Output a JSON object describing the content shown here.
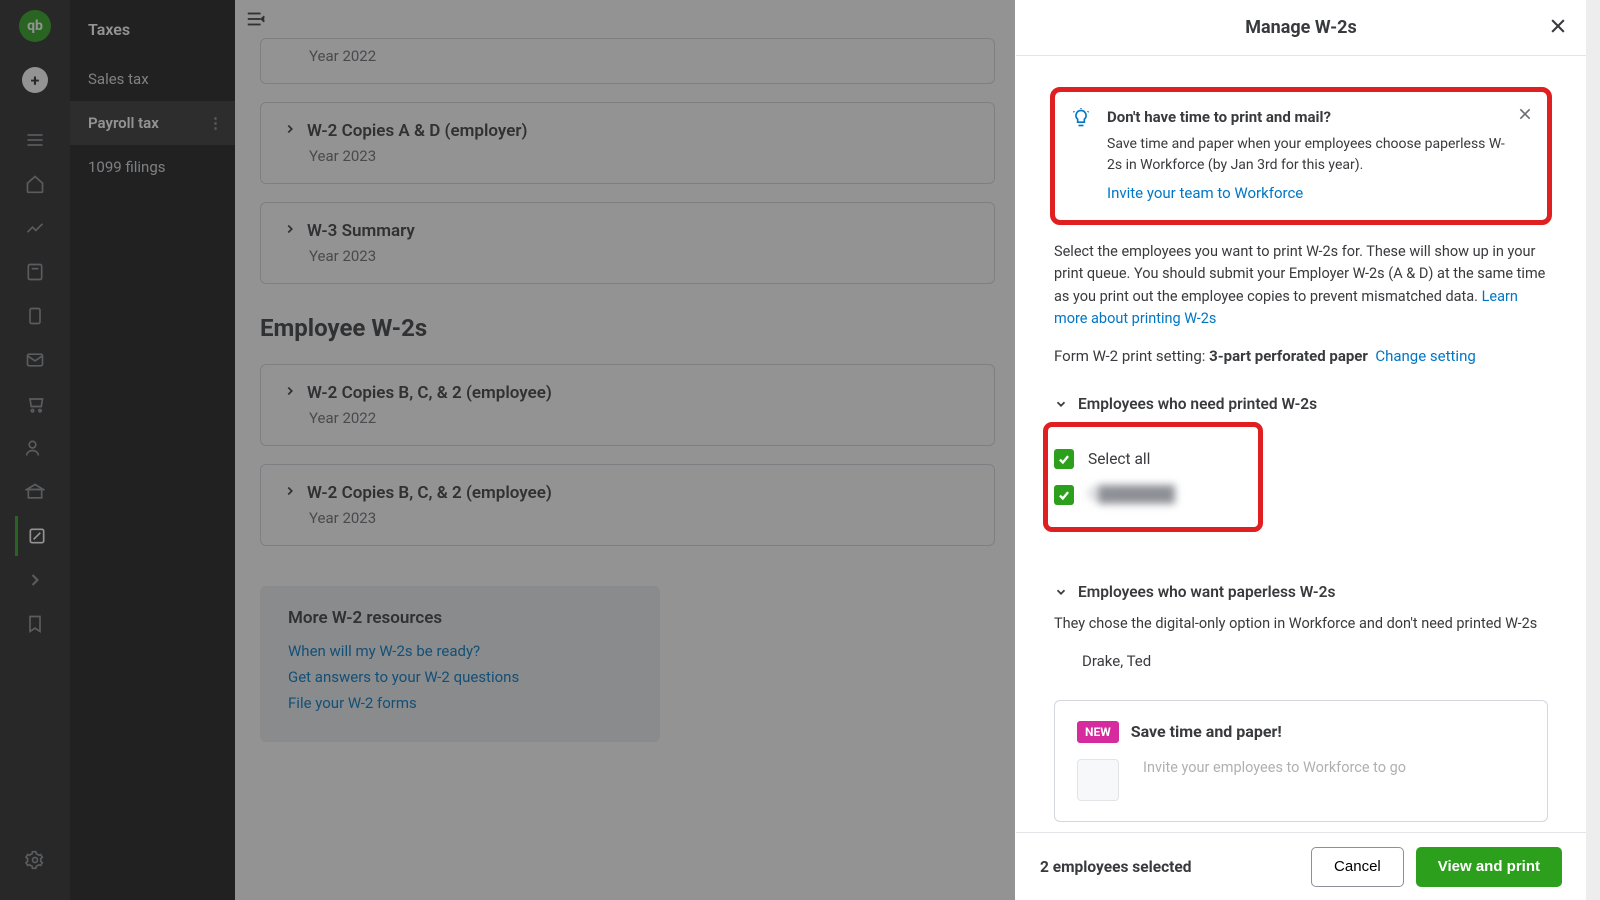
{
  "sidebar": {
    "title": "Taxes",
    "items": [
      "Sales tax",
      "Payroll tax",
      "1099 filings"
    ],
    "activeIndex": 1
  },
  "cards": [
    {
      "title": "",
      "sub": "Year 2022"
    },
    {
      "title": "W-2 Copies A & D (employer)",
      "sub": "Year 2023"
    },
    {
      "title": "W-3 Summary",
      "sub": "Year 2023"
    }
  ],
  "sectionHeading": "Employee W-2s",
  "empCards": [
    {
      "title": "W-2 Copies B, C, & 2 (employee)",
      "sub": "Year 2022"
    },
    {
      "title": "W-2 Copies B, C, & 2 (employee)",
      "sub": "Year 2023"
    }
  ],
  "resources": {
    "heading": "More W-2 resources",
    "links": [
      "When will my W-2s be ready?",
      "Get answers to your W-2 questions",
      "File your W-2 forms"
    ]
  },
  "drawer": {
    "title": "Manage W-2s",
    "tip": {
      "heading": "Don't have time to print and mail?",
      "body": "Save time and paper when your employees choose paperless W-2s in Workforce (by Jan 3rd for this year).",
      "link": "Invite your team to Workforce"
    },
    "blurb": "Select the employees you want to print W-2s for. These will show up in your print queue. You should submit your Employer W-2s (A & D) at the same time as you print out the employee copies to prevent mismatched data. ",
    "learnMore": "Learn more about printing W-2s",
    "settingLabel": "Form W-2 print setting: ",
    "settingValue": "3-part perforated paper",
    "changeSetting": "Change setting",
    "printedHeader": "Employees who need printed W-2s",
    "selectAll": "Select all",
    "employee1": "C███████",
    "paperlessHeader": "Employees who want paperless W-2s",
    "paperlessBody": "They chose the digital-only option in Workforce and don't need printed W-2s",
    "paperlessEmployee": "Drake, Ted",
    "promoBadge": "NEW",
    "promoHeading": "Save time and paper!",
    "promoBody": "Invite your employees to Workforce to go",
    "footerCount": "2 employees selected",
    "cancel": "Cancel",
    "submit": "View and print"
  }
}
